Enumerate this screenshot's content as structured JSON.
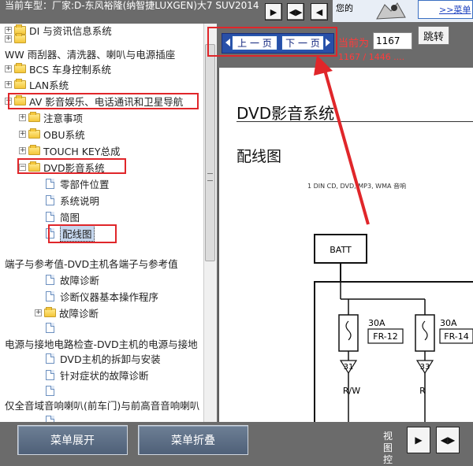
{
  "header": {
    "car_label": "当前车型：厂家:D-东风裕隆(纳智捷LUXGEN)大7 SUV2014",
    "banner_text": "您的",
    "banner_link": ">>菜单"
  },
  "tree": {
    "rows": [
      {
        "label": "DI 与资讯信息系统",
        "level": 0
      },
      {
        "label": "",
        "level": 0
      },
      {
        "label": "WW 雨刮器、清洗器、喇叭与电源插座",
        "level": 0
      },
      {
        "label": "BCS 车身控制系统",
        "level": 0
      },
      {
        "label": "LAN系统",
        "level": 0
      },
      {
        "label": "AV 影音娱乐、电话通讯和卫星导航",
        "level": 0
      },
      {
        "label": "注意事项",
        "level": 1
      },
      {
        "label": "OBU系统",
        "level": 1
      },
      {
        "label": "TOUCH KEY总成",
        "level": 1
      },
      {
        "label": "DVD影音系统",
        "level": 1
      },
      {
        "label": "零部件位置",
        "level": 2
      },
      {
        "label": "系统说明",
        "level": 2
      },
      {
        "label": "简图",
        "level": 2
      },
      {
        "label": "配线图",
        "level": 2
      },
      {
        "label": "端子与参考值-DVD主机各端子与参考值",
        "level": 2
      },
      {
        "label": "故障诊断",
        "level": 2
      },
      {
        "label": "诊断仪器基本操作程序",
        "level": 2
      },
      {
        "label": "故障诊断",
        "level": 2
      },
      {
        "label": "",
        "level": 2
      },
      {
        "label": "电源与接地电路检查-DVD主机的电源与接地",
        "level": 2
      },
      {
        "label": "DVD主机的拆卸与安装",
        "level": 2
      },
      {
        "label": "针对症状的故障诊断",
        "level": 2
      },
      {
        "label": "",
        "level": 2
      },
      {
        "label": "仅全音域音响喇叭(前车门)与前高音音响喇叭",
        "level": 2
      }
    ]
  },
  "pager": {
    "prev_label": "上 一 页",
    "next_label": "下 一 页",
    "current_label": "当前为",
    "current_value": "1167",
    "jump_label": "跳转",
    "count_text": "1167 / 1446 ...."
  },
  "document": {
    "title": "DVD影音系统",
    "subtitle": "配线图",
    "caption": "1 DIN CD, DVD, MP3, WMA 音响",
    "batt_label": "BATT",
    "fuse1_amp": "30A",
    "fuse1_name": "FR-12",
    "fuse2_amp": "30A",
    "fuse2_name": "FR-14",
    "pin1": "31",
    "pin2": "33",
    "wire1": "R/W",
    "wire2": "R"
  },
  "bottom": {
    "expand_label": "菜单展开",
    "collapse_label": "菜单折叠",
    "view_label": "视图控"
  }
}
